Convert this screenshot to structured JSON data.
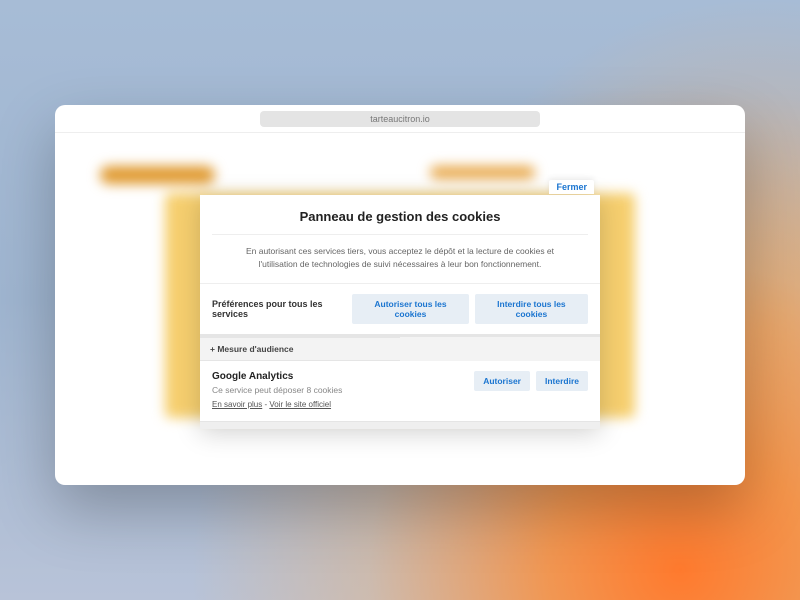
{
  "url": "tarteaucitron.io",
  "panel": {
    "close": "Fermer",
    "title": "Panneau de gestion des cookies",
    "description": "En autorisant ces services tiers, vous acceptez le dépôt et la lecture de cookies et l'utilisation de technologies de suivi nécessaires à leur bon fonctionnement.",
    "prefs_label": "Préférences pour tous les services",
    "allow_all": "Autoriser tous les cookies",
    "deny_all": "Interdire tous les cookies",
    "category": "+ Mesure d'audience",
    "service": {
      "name": "Google Analytics",
      "desc": "Ce service peut déposer 8 cookies",
      "learn_more": "En savoir plus",
      "sep": " - ",
      "official": "Voir le site officiel",
      "allow": "Autoriser",
      "deny": "Interdire"
    }
  }
}
